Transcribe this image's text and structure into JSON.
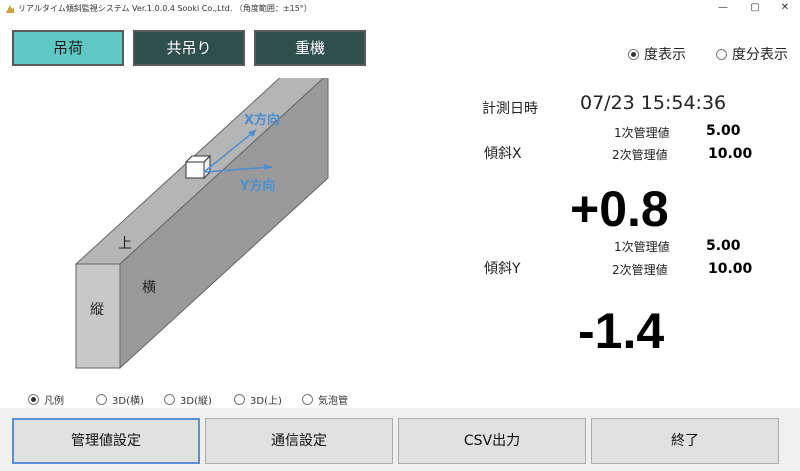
{
  "window": {
    "title": "リアルタイム傾斜監視システム Ver.1.0.0.4 Sooki Co.,Ltd. （角度範囲：±15°）",
    "minimize": "—",
    "maximize": "▢",
    "close": "✕"
  },
  "modes": [
    {
      "label": "吊荷",
      "active": true
    },
    {
      "label": "共吊り",
      "active": false
    },
    {
      "label": "重機",
      "active": false
    }
  ],
  "display_options": [
    {
      "label": "度表示",
      "checked": true
    },
    {
      "label": "度分表示",
      "checked": false
    }
  ],
  "diagram": {
    "x_dir": "X方向",
    "y_dir": "Y方向",
    "top": "上",
    "side": "横",
    "front": "縦"
  },
  "view_options": [
    {
      "label": "凡例",
      "checked": true
    },
    {
      "label": "3D(横)",
      "checked": false
    },
    {
      "label": "3D(縦)",
      "checked": false
    },
    {
      "label": "3D(上)",
      "checked": false
    },
    {
      "label": "気泡管",
      "checked": false
    }
  ],
  "measure": {
    "datetime_label": "計測日時",
    "datetime": "07/23 15:54:36",
    "x": {
      "label": "傾斜X",
      "limit1_label": "1次管理値",
      "limit1": "5.00",
      "limit2_label": "2次管理値",
      "limit2": "10.00",
      "value": "+0.8"
    },
    "y": {
      "label": "傾斜Y",
      "limit1_label": "1次管理値",
      "limit1": "5.00",
      "limit2_label": "2次管理値",
      "limit2": "10.00",
      "value": "-1.4"
    }
  },
  "buttons": {
    "settings": "管理値設定",
    "comm": "通信設定",
    "csv": "CSV出力",
    "exit": "終了"
  }
}
